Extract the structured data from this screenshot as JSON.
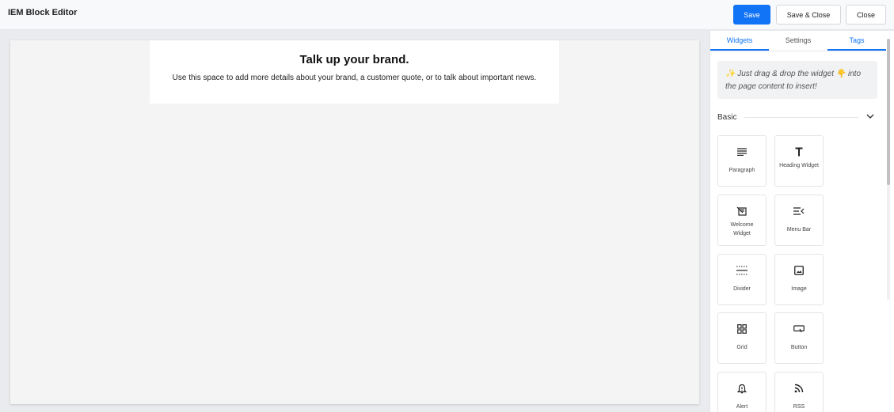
{
  "header": {
    "title": "IEM Block Editor",
    "save_label": "Save",
    "save_close_label": "Save & Close",
    "close_label": "Close",
    "accent_color": "#1173f5"
  },
  "canvas": {
    "heading": "Talk up your brand.",
    "text": "Use this space to add more details about your brand, a customer quote, or to talk about important news."
  },
  "panel": {
    "tabs": [
      {
        "label": "Widgets",
        "active": true
      },
      {
        "label": "Settings",
        "active": false
      },
      {
        "label": "Tags",
        "active": false
      }
    ],
    "info_text": "✨ Just drag & drop the widget 👇 into the page content to insert!",
    "section_label": "Basic",
    "widgets": [
      {
        "label": "Paragraph",
        "icon": "paragraph-icon"
      },
      {
        "label": "Heading Widget",
        "icon": "heading-icon"
      },
      {
        "label": "Welcome Widget",
        "icon": "welcome-icon"
      },
      {
        "label": "Menu Bar",
        "icon": "menu-bar-icon"
      },
      {
        "label": "Divider",
        "icon": "divider-icon"
      },
      {
        "label": "Image",
        "icon": "image-icon"
      },
      {
        "label": "Grid",
        "icon": "grid-icon"
      },
      {
        "label": "Button",
        "icon": "button-icon"
      },
      {
        "label": "Alert",
        "icon": "bell-icon"
      },
      {
        "label": "RSS",
        "icon": "rss-icon"
      }
    ]
  }
}
